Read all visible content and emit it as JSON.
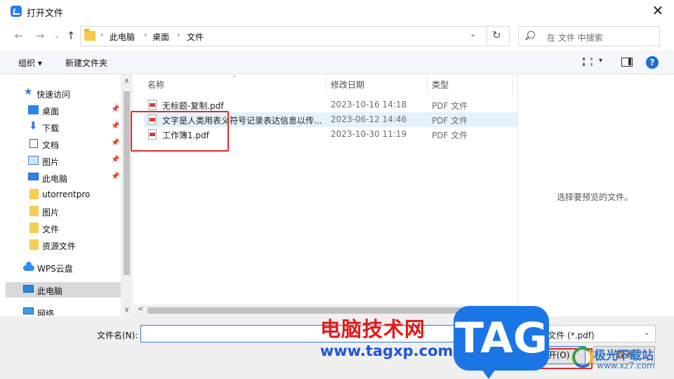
{
  "window": {
    "title": "打开文件",
    "close_glyph": "✕"
  },
  "nav": {
    "back_glyph": "←",
    "forward_glyph": "→",
    "recent_glyph": "⌄",
    "up_glyph": "↑",
    "breadcrumb": [
      "此电脑",
      "桌面",
      "文件"
    ],
    "sep_glyph": "›",
    "dropdown_glyph": "⌄",
    "refresh_glyph": "↻",
    "search_placeholder": "在 文件 中搜索"
  },
  "toolbar": {
    "organize": "组织 ▾",
    "new_folder": "新建文件夹",
    "view_dd": "▾",
    "help": "?"
  },
  "sidebar": {
    "items": [
      {
        "label": "快速访问",
        "icon": "star-icon"
      },
      {
        "label": "桌面",
        "icon": "desktop-icon",
        "pinned": true
      },
      {
        "label": "下载",
        "icon": "download-icon",
        "pinned": true
      },
      {
        "label": "文档",
        "icon": "document-icon",
        "pinned": true
      },
      {
        "label": "图片",
        "icon": "picture-icon",
        "pinned": true
      },
      {
        "label": "此电脑",
        "icon": "computer-icon",
        "pinned": true
      },
      {
        "label": "utorrentpro",
        "icon": "folder-icon"
      },
      {
        "label": "图片",
        "icon": "folder-icon"
      },
      {
        "label": "文件",
        "icon": "folder-icon"
      },
      {
        "label": "资源文件",
        "icon": "folder-icon"
      },
      {
        "label": "WPS云盘",
        "icon": "cloud-icon"
      },
      {
        "label": "此电脑",
        "icon": "computer-icon",
        "selected": true
      },
      {
        "label": "网络",
        "icon": "network-icon"
      }
    ],
    "pin_glyph": "📌",
    "scroll_up": "∧",
    "scroll_down": "∨"
  },
  "filelist": {
    "columns": [
      "名称",
      "修改日期",
      "类型"
    ],
    "sort_glyph": "⌄",
    "rows": [
      {
        "name": "无标题-复制.pdf",
        "date": "2023-10-16 14:18",
        "type": "PDF 文件"
      },
      {
        "name": "文字是人类用表义符号记录表达信息以传...",
        "date": "2023-06-12 14:46",
        "type": "PDF 文件",
        "highlighted": true
      },
      {
        "name": "工作簿1.pdf",
        "date": "2023-10-30 11:19",
        "type": "PDF 文件"
      }
    ],
    "hscroll_left": "<"
  },
  "preview": {
    "text": "选择要预览的文件。"
  },
  "bottom": {
    "filename_label": "文件名(N):",
    "filename_value": "",
    "type_value": "PDF 文件 (*.pdf)",
    "type_dd": "⌄",
    "open_button": "打开(O)",
    "cancel_button": "取消"
  },
  "watermark": {
    "cn_text": "电脑技术网",
    "url": "www.tagxp.com",
    "badge": "TAG",
    "logo_text": "极光下载站",
    "logo_url": "www.xz7.com"
  },
  "colors": {
    "accent": "#2a7be0",
    "annotation": "#e02c2c",
    "badge": "#1a76e4"
  }
}
